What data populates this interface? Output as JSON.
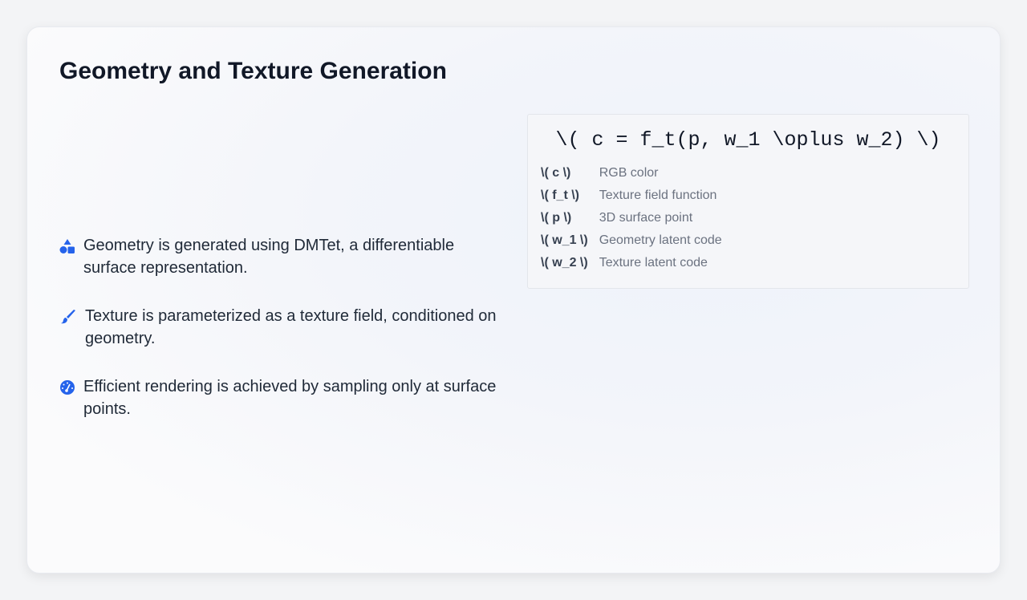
{
  "title": "Geometry and Texture Generation",
  "accent_color": "#2563eb",
  "bullets": [
    {
      "icon": "shapes-icon",
      "text": "Geometry is generated using DMTet, a differentiable surface representation."
    },
    {
      "icon": "paintbrush-icon",
      "text": "Texture is parameterized as a texture field, conditioned on geometry."
    },
    {
      "icon": "gauge-icon",
      "text": "Efficient rendering is achieved by sampling only at surface points."
    }
  ],
  "formula": "\\( c = f_t(p, w_1 \\oplus w_2) \\)",
  "legend": [
    {
      "symbol": "\\( c \\)",
      "desc": "RGB color"
    },
    {
      "symbol": "\\( f_t \\)",
      "desc": "Texture field function"
    },
    {
      "symbol": "\\( p \\)",
      "desc": "3D surface point"
    },
    {
      "symbol": "\\( w_1 \\)",
      "desc": "Geometry latent code"
    },
    {
      "symbol": "\\( w_2 \\)",
      "desc": "Texture latent code"
    }
  ]
}
